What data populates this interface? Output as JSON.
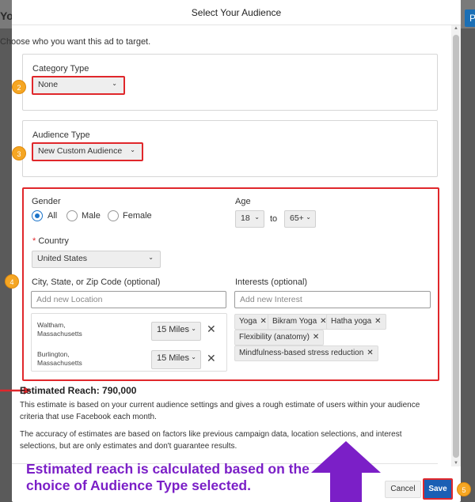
{
  "background": {
    "page_title": "Yo",
    "button_label": "P"
  },
  "modal": {
    "title": "Select Your Audience",
    "intro": "Choose who you want this ad to target."
  },
  "category": {
    "label": "Category Type",
    "value": "None",
    "badge": "2"
  },
  "audience": {
    "label": "Audience Type",
    "value": "New Custom Audience",
    "badge": "3"
  },
  "targeting": {
    "badge": "4",
    "gender_label": "Gender",
    "gender_options": [
      "All",
      "Male",
      "Female"
    ],
    "gender_selected": "All",
    "age_label": "Age",
    "age_min": "18",
    "age_to": "to",
    "age_max": "65+",
    "country_required_mark": "*",
    "country_label": "Country",
    "country_value": "United States",
    "location_label": "City, State, or Zip Code (optional)",
    "location_placeholder": "Add new Location",
    "locations": [
      {
        "city": "Waltham,",
        "state": "Massachusetts",
        "radius": "15 Miles"
      },
      {
        "city": "Burlington,",
        "state": "Massachusetts",
        "radius": "15 Miles"
      }
    ],
    "interests_label": "Interests (optional)",
    "interests_placeholder": "Add new Interest",
    "interests": [
      "Yoga",
      "Bikram Yoga",
      "Hatha yoga",
      "Flexibility (anatomy)",
      "Mindfulness-based stress reduction"
    ]
  },
  "reach": {
    "title": "Estimated Reach: 790,000",
    "paragraph1": "This estimate is based on your current audience settings and gives a rough estimate of users within your audience criteria that use Facebook each month.",
    "paragraph2": "The accuracy of estimates are based on factors like previous campaign data, location selections, and interest selections, but are only estimates and don't guarantee results."
  },
  "annotation": {
    "caption_line1": "Estimated reach is calculated based on the",
    "caption_line2": "choice of Audience Type selected.",
    "arrow_color": "#7b1fc7",
    "pointer_color": "#e0272b"
  },
  "footer": {
    "cancel_label": "Cancel",
    "save_label": "Save",
    "save_badge": "5"
  },
  "colors": {
    "accent": "#1a73c9",
    "highlight": "#e0272b",
    "badge": "#f5a623"
  }
}
